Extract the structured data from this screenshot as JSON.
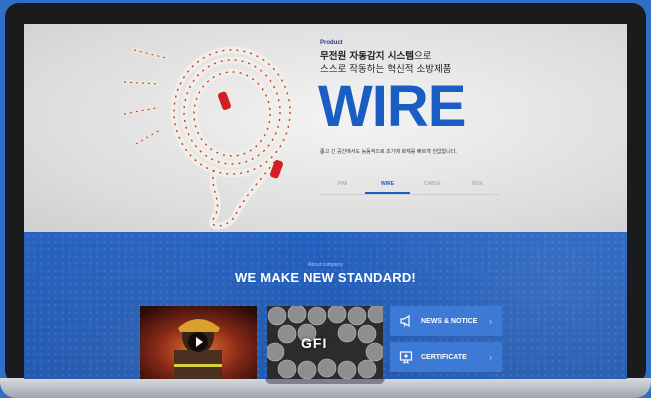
{
  "hero": {
    "product_label": "Product",
    "headline_bold": "무전원 자동감지 시스템",
    "headline_light1": "으로",
    "headline_line2": "스스로 작동하는 혁신적 소방제품",
    "title": "WIRE",
    "description": "좁고 긴 공간에서도 능동적으로 초기에 화재를 빠르게 진압합니다.",
    "tabs": [
      {
        "label": "PWI",
        "active": false
      },
      {
        "label": "WIRE",
        "active": true
      },
      {
        "label": "CABLE",
        "active": false
      },
      {
        "label": "BOX",
        "active": false
      }
    ]
  },
  "about": {
    "kicker": "About company",
    "title": "WE MAKE NEW STANDARD!"
  },
  "cards": {
    "video_icon": "play-icon",
    "gfi_logo_text": "GFI",
    "news_label": "NEWS & NOTICE",
    "news_icon": "megaphone-icon",
    "cert_label": "CERTIFICATE",
    "cert_icon": "certificate-icon",
    "arrow": "›"
  },
  "colors": {
    "brand_blue": "#1a5ec4",
    "section_blue": "#2461bf",
    "card_blue": "#3d7ad6"
  }
}
